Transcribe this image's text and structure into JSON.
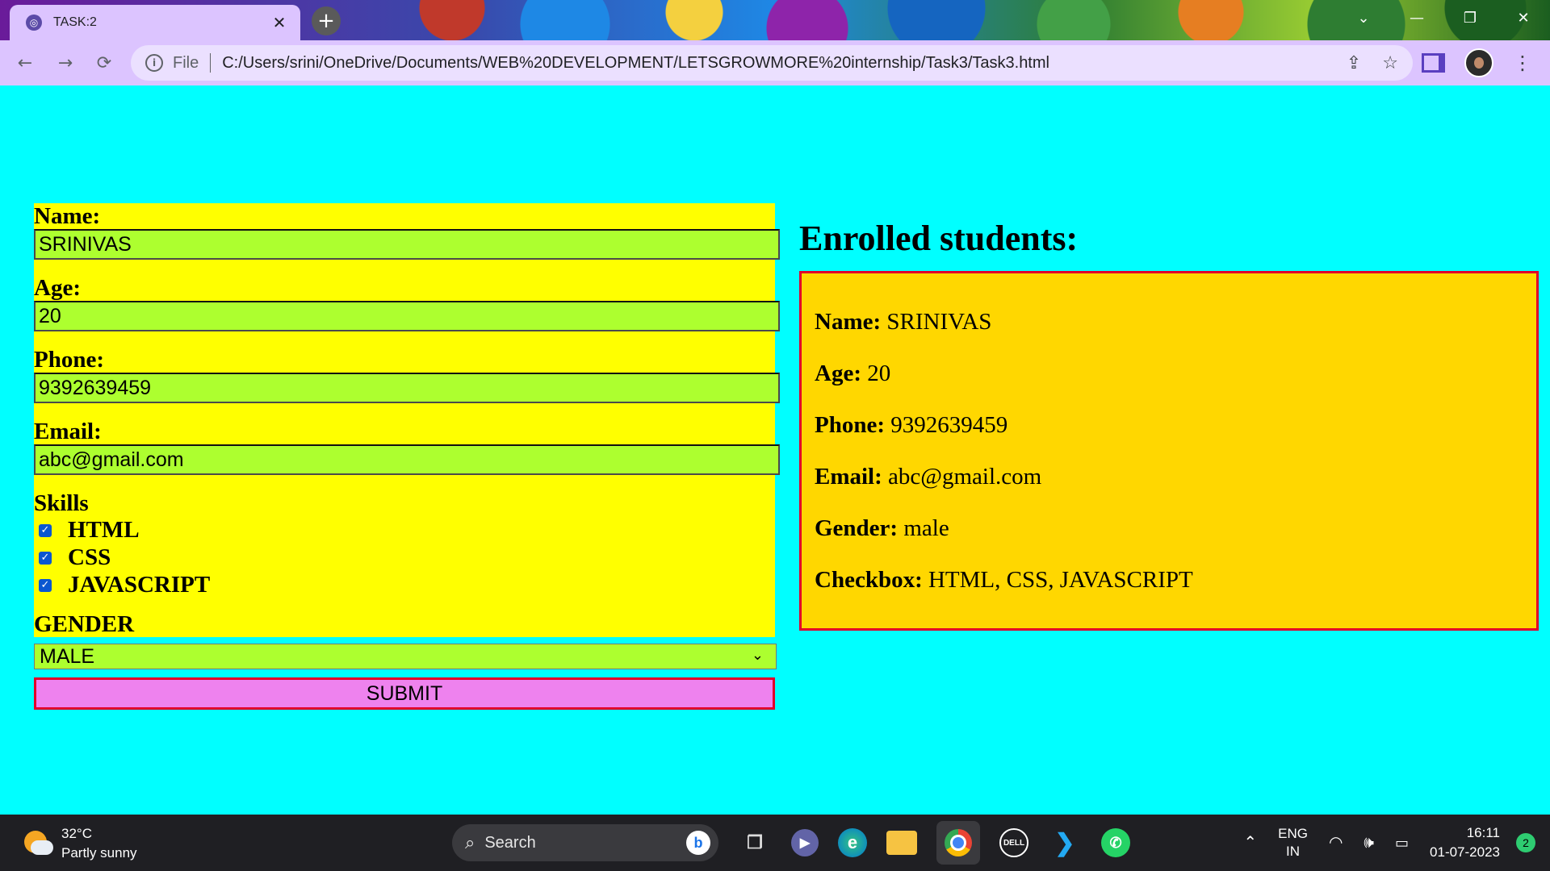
{
  "browser": {
    "tab_title": "TASK:2",
    "tab_close": "✕",
    "new_tab": "+",
    "file_label": "File",
    "url": "C:/Users/srini/OneDrive/Documents/WEB%20DEVELOPMENT/LETSGROWMORE%20internship/Task3/Task3.html",
    "nav": {
      "back": "←",
      "forward": "→",
      "reload": "⟳"
    },
    "window_controls": [
      "⌄",
      "—",
      "❐",
      "✕"
    ],
    "colors": {
      "tab_bg": "#dcc4ff",
      "omnibox_bg": "#ebe0ff"
    }
  },
  "form": {
    "name_label": "Name:",
    "name_value": "SRINIVAS",
    "age_label": "Age:",
    "age_value": "20",
    "phone_label": "Phone:",
    "phone_value": "9392639459",
    "email_label": "Email:",
    "email_value": "abc@gmail.com",
    "skills_label": "Skills",
    "skills": [
      {
        "label": "HTML",
        "checked": true
      },
      {
        "label": "CSS",
        "checked": true
      },
      {
        "label": "JAVASCRIPT",
        "checked": true
      }
    ],
    "gender_label": "GENDER",
    "gender_selected": "MALE",
    "submit_label": "SUBMIT",
    "colors": {
      "panel": "#ffff00",
      "input": "#adff2f",
      "submit": "#ee82ee",
      "submit_border": "#e0002a"
    }
  },
  "enrolled": {
    "title": "Enrolled students:",
    "rows": [
      {
        "key": "Name:",
        "value": "SRINIVAS"
      },
      {
        "key": "Age:",
        "value": "20"
      },
      {
        "key": "Phone:",
        "value": "9392639459"
      },
      {
        "key": "Email:",
        "value": "abc@gmail.com"
      },
      {
        "key": "Gender:",
        "value": "male"
      },
      {
        "key": "Checkbox:",
        "value": "HTML, CSS, JAVASCRIPT"
      }
    ],
    "colors": {
      "card": "#ffd700",
      "border": "#e0002a"
    }
  },
  "page_background": "#00ffff",
  "taskbar": {
    "temperature": "32°C",
    "weather": "Partly sunny",
    "search_placeholder": "Search",
    "language": "ENG",
    "region": "IN",
    "time": "16:11",
    "date": "01-07-2023",
    "notification_count": "2",
    "apps": [
      "windows-start",
      "task-view",
      "teams-chat",
      "edge",
      "file-explorer",
      "chrome",
      "dell",
      "vscode",
      "whatsapp"
    ]
  }
}
